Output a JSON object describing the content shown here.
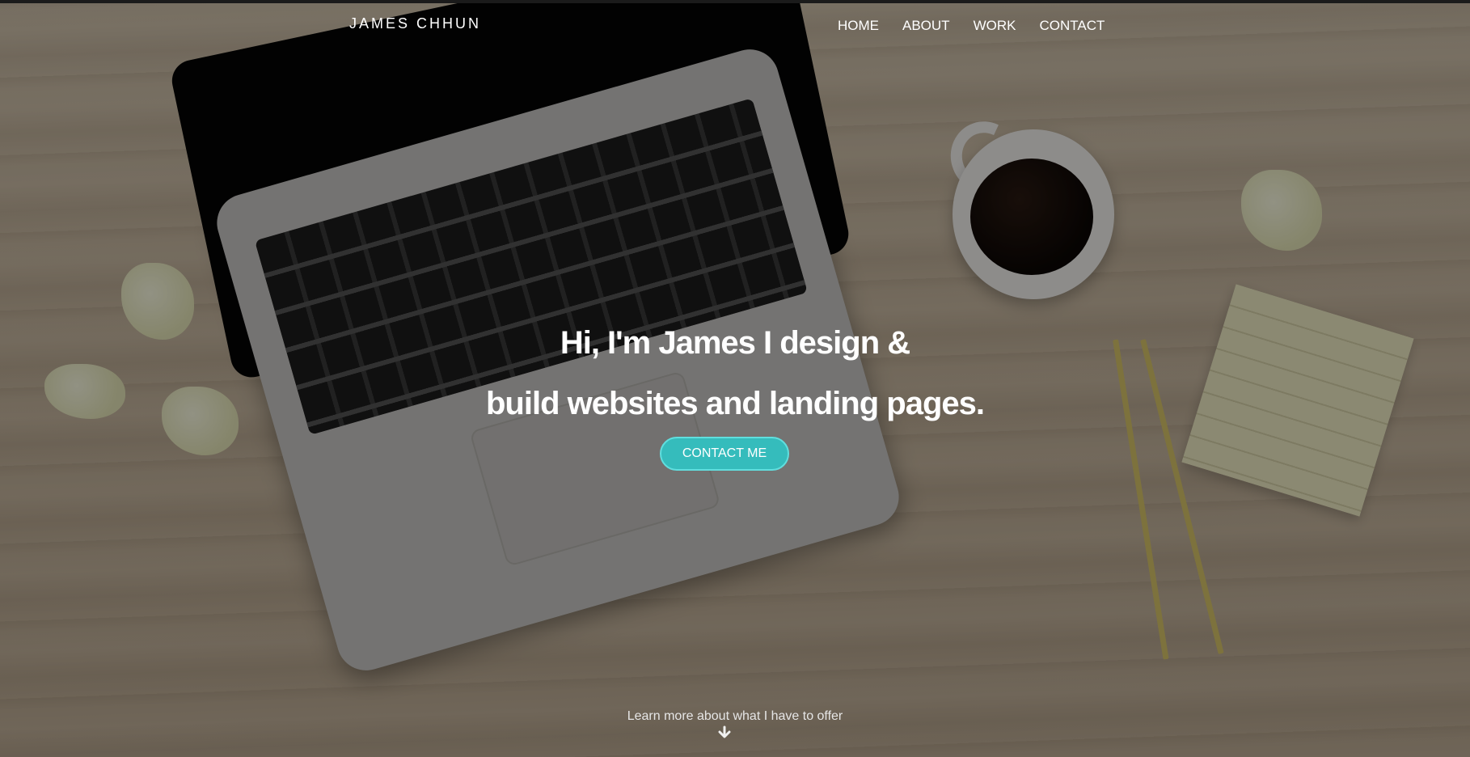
{
  "header": {
    "brand": "JAMES CHHUN",
    "nav": [
      "HOME",
      "ABOUT",
      "WORK",
      "CONTACT"
    ]
  },
  "hero": {
    "headline_line1": "Hi, I'm James I design &",
    "headline_line2": "build websites and landing pages.",
    "cta_label": "CONTACT ME",
    "learn_more": "Learn more about what I have to offer",
    "arrow_icon": "arrow-down-icon"
  },
  "colors": {
    "accent": "#35bcbc",
    "text": "#ffffff"
  }
}
